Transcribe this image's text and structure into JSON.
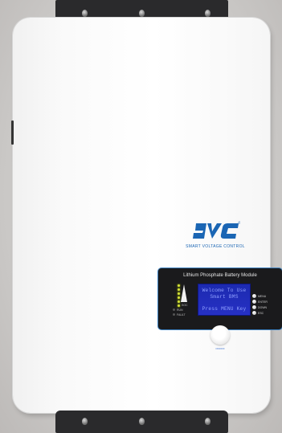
{
  "brand": {
    "name": "SVC",
    "tagline": "SMART VOLTAGE CONTROL",
    "color": "#1b66b4"
  },
  "panel": {
    "title": "Lithium Phosphate Battery Module",
    "soc_label": "SOC",
    "status_labels": [
      "RUN",
      "FAULT"
    ],
    "lcd": {
      "line1": "Welcome To Use",
      "line2": "Smart BMS",
      "line3": "Press MENU Key",
      "color": "#2630c4"
    },
    "buttons": [
      "MENU",
      "ENTER",
      "DOWN",
      "ESC"
    ]
  },
  "power": {
    "label": "ON/OFF"
  }
}
